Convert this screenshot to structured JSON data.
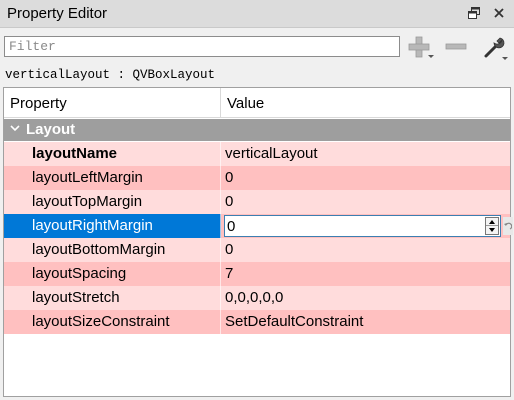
{
  "window": {
    "title": "Property Editor",
    "float_icon": "float-dock-icon",
    "close_icon": "close-icon",
    "float_glyph": "🗗",
    "close_glyph": "✕"
  },
  "filter": {
    "placeholder": "Filter",
    "value": ""
  },
  "toolbar": {
    "add_icon": "plus-icon",
    "remove_icon": "minus-icon",
    "config_icon": "wrench-icon"
  },
  "object_label": "verticalLayout : QVBoxLayout",
  "table": {
    "headers": {
      "property": "Property",
      "value": "Value"
    },
    "group": {
      "label": "Layout",
      "expand_glyph": "⌄"
    },
    "rows": [
      {
        "name": "layoutName",
        "value": "verticalLayout",
        "bold": true,
        "shade": "light",
        "selected": false
      },
      {
        "name": "layoutLeftMargin",
        "value": "0",
        "bold": false,
        "shade": "dark",
        "selected": false
      },
      {
        "name": "layoutTopMargin",
        "value": "0",
        "bold": false,
        "shade": "light",
        "selected": false
      },
      {
        "name": "layoutRightMargin",
        "value": "0",
        "bold": false,
        "shade": "dark",
        "selected": true
      },
      {
        "name": "layoutBottomMargin",
        "value": "0",
        "bold": false,
        "shade": "light",
        "selected": false
      },
      {
        "name": "layoutSpacing",
        "value": "7",
        "bold": false,
        "shade": "dark",
        "selected": false
      },
      {
        "name": "layoutStretch",
        "value": "0,0,0,0,0",
        "bold": false,
        "shade": "light",
        "selected": false
      },
      {
        "name": "layoutSizeConstraint",
        "value": "SetDefaultConstraint",
        "bold": false,
        "shade": "dark",
        "selected": false
      }
    ]
  },
  "colors": {
    "row_light": "#ffdcdc",
    "row_dark": "#ffc0c0",
    "group_header": "#9e9e9e",
    "selection": "#0078d7"
  }
}
